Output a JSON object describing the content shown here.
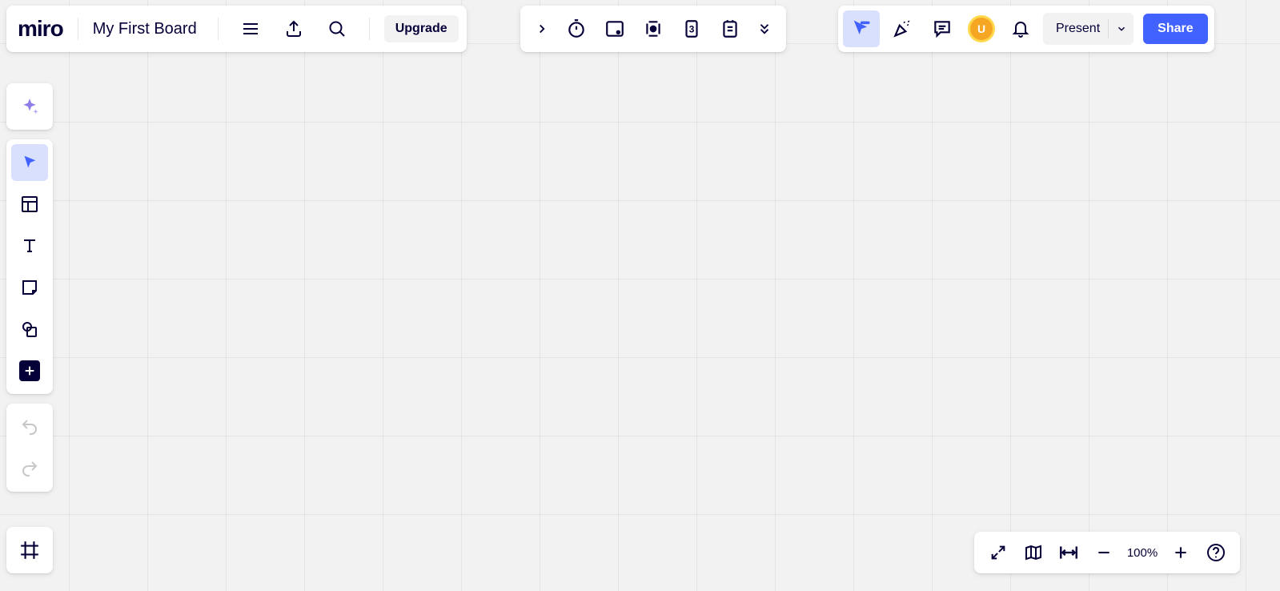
{
  "app": {
    "logo_text": "miro",
    "board_title": "My First Board",
    "upgrade_label": "Upgrade"
  },
  "header_right": {
    "avatar_initial": "U",
    "present_label": "Present",
    "share_label": "Share"
  },
  "zoom": {
    "level_label": "100%"
  },
  "center_toolbar": {
    "calendar_day": "3"
  }
}
